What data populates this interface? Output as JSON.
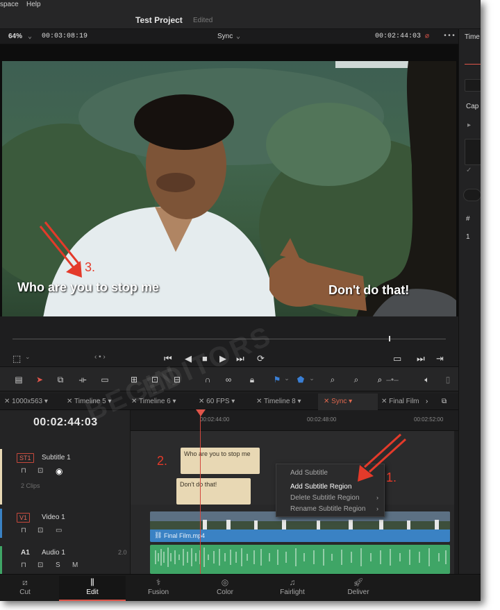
{
  "menubar": {
    "items": [
      "space",
      "Help"
    ]
  },
  "project": {
    "title": "Test Project",
    "status": "Edited"
  },
  "viewer": {
    "zoom": "64%",
    "duration_tc": "00:03:08:19",
    "sync_label": "Sync",
    "current_tc": "00:02:44:03",
    "subtitle_left": "Who are you to stop me",
    "subtitle_right": "Don't do that!"
  },
  "right_panel": {
    "label_top": "Time",
    "label_cap": "Cap",
    "label_hash": "#",
    "value_one": "1"
  },
  "tabs": [
    {
      "label": "1000x563",
      "active": false
    },
    {
      "label": "Timeline 5",
      "active": false
    },
    {
      "label": "Timeline 6",
      "active": false
    },
    {
      "label": "60 FPS",
      "active": false
    },
    {
      "label": "Timeline 8",
      "active": false
    },
    {
      "label": "Sync",
      "active": true
    },
    {
      "label": "Final Film",
      "active": false
    }
  ],
  "timeline": {
    "timecode": "00:02:44:03",
    "ruler": [
      "00:02:44:00",
      "00:02:48:00",
      "00:02:52:00"
    ],
    "tracks": {
      "st1": {
        "tag": "ST1",
        "name": "Subtitle 1",
        "clips": "2 Clips"
      },
      "v1": {
        "tag": "V1",
        "name": "Video 1"
      },
      "a1": {
        "tag": "A1",
        "name": "Audio 1",
        "level": "2.0"
      }
    },
    "sub_clip_1": "Who are you to stop me",
    "sub_clip_2": "Don't do that!",
    "video_clip": "Final Film.mp4"
  },
  "context_menu": {
    "items": [
      {
        "label": "Add Subtitle",
        "highlight": false,
        "submenu": false
      },
      {
        "label": "Add Subtitle Region",
        "highlight": true,
        "submenu": false
      },
      {
        "label": "Delete Subtitle Region",
        "highlight": false,
        "submenu": true
      },
      {
        "label": "Rename Subtitle Region",
        "highlight": false,
        "submenu": true
      }
    ]
  },
  "annotations": {
    "one": "1.",
    "two": "2.",
    "three": "3."
  },
  "pages": [
    {
      "label": "Cut",
      "icon": "cut-page-icon",
      "active": false
    },
    {
      "label": "Edit",
      "icon": "edit-page-icon",
      "active": true
    },
    {
      "label": "Fusion",
      "icon": "fusion-page-icon",
      "active": false
    },
    {
      "label": "Color",
      "icon": "color-page-icon",
      "active": false
    },
    {
      "label": "Fairlight",
      "icon": "fairlight-page-icon",
      "active": false
    },
    {
      "label": "Deliver",
      "icon": "deliver-page-icon",
      "active": false
    }
  ],
  "colors": {
    "accent": "#e0554a",
    "subtitle_clip": "#e8d8b4",
    "video_track": "#3a82c4",
    "audio_track": "#3fa566",
    "annotation": "#e43a2a"
  }
}
